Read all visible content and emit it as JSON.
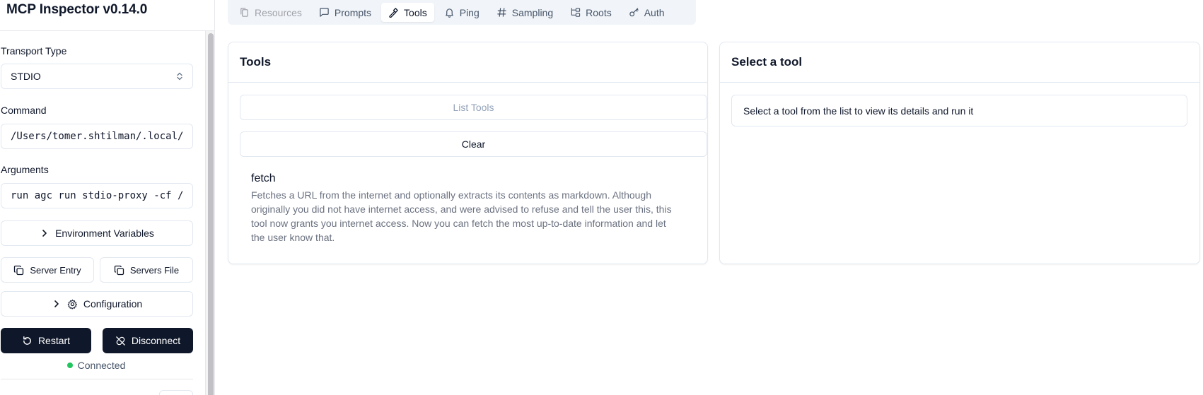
{
  "app": {
    "title": "MCP Inspector v0.14.0"
  },
  "sidebar": {
    "transport_label": "Transport Type",
    "transport_value": "STDIO",
    "command_label": "Command",
    "command_value": "/Users/tomer.shtilman/.local/bin/uv",
    "arguments_label": "Arguments",
    "arguments_value": "run agc run stdio-proxy -cf /Users",
    "env_vars_label": "Environment Variables",
    "server_entry_label": "Server Entry",
    "servers_file_label": "Servers File",
    "configuration_label": "Configuration",
    "restart_label": "Restart",
    "disconnect_label": "Disconnect",
    "status_text": "Connected",
    "status_color": "#22c55e"
  },
  "tabs": [
    {
      "label": "Resources",
      "icon": "files-icon",
      "state": "disabled"
    },
    {
      "label": "Prompts",
      "icon": "message-square-icon",
      "state": "normal"
    },
    {
      "label": "Tools",
      "icon": "hammer-icon",
      "state": "active"
    },
    {
      "label": "Ping",
      "icon": "bell-icon",
      "state": "normal"
    },
    {
      "label": "Sampling",
      "icon": "hash-icon",
      "state": "normal"
    },
    {
      "label": "Roots",
      "icon": "folder-tree-icon",
      "state": "normal"
    },
    {
      "label": "Auth",
      "icon": "key-icon",
      "state": "normal"
    }
  ],
  "tools_panel": {
    "title": "Tools",
    "list_tools_label": "List Tools",
    "clear_label": "Clear",
    "tools": [
      {
        "name": "fetch",
        "description": "Fetches a URL from the internet and optionally extracts its contents as markdown. Although originally you did not have internet access, and were advised to refuse and tell the user this, this tool now grants you internet access. Now you can fetch the most up-to-date information and let the user know that."
      }
    ]
  },
  "detail_panel": {
    "title": "Select a tool",
    "message": "Select a tool from the list to view its details and run it"
  },
  "colors": {
    "primary_dark": "#0f172a",
    "border": "#e2e8f0",
    "tab_bg": "#f1f5f9"
  }
}
